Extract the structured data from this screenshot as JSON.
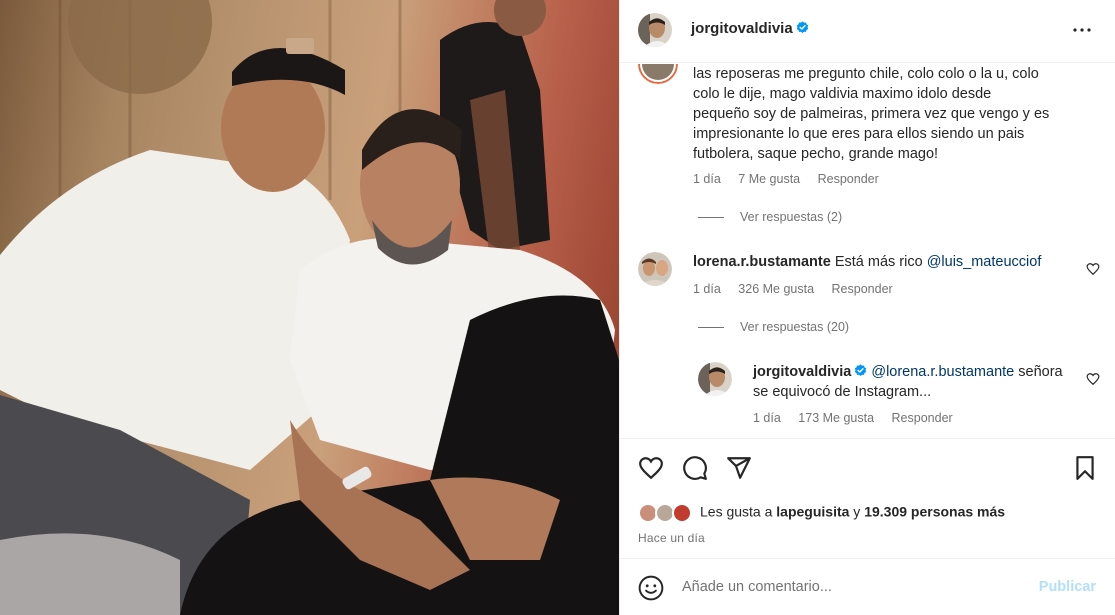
{
  "post": {
    "username": "jorgitovaldivia",
    "more_icon": "more-horizontal-icon"
  },
  "comments": {
    "first": {
      "lines": [
        "las reposeras me pregunto chile, colo colo o la u, colo",
        "colo le dije, mago valdivia maximo idolo desde",
        "pequeño soy de palmeiras, primera vez que vengo y es",
        "impresionante lo que eres para ellos siendo un pais",
        "futbolera, saque pecho, grande mago!"
      ],
      "time": "1 día",
      "likes": "7 Me gusta",
      "reply": "Responder",
      "view_replies": "Ver respuestas (2)"
    },
    "second": {
      "username": "lorena.r.bustamante",
      "text": "Está más rico ",
      "mention": "@luis_mateucciof",
      "time": "1 día",
      "likes": "326 Me gusta",
      "reply": "Responder",
      "view_replies": "Ver respuestas (20)"
    },
    "reply": {
      "username": "jorgitovaldivia",
      "mention": "@lorena.r.bustamante",
      "text_line1": " señora",
      "text_line2": "se equivocó de Instagram...",
      "time": "1 día",
      "likes": "173 Me gusta",
      "reply": "Responder"
    }
  },
  "actions": {
    "likes_prefix": "Les gusta a ",
    "likes_user": "lapeguisita",
    "likes_middle": " y ",
    "likes_count": "19.309 personas más",
    "time_ago": "Hace un día"
  },
  "compose": {
    "placeholder": "Añade un comentario...",
    "post_label": "Publicar"
  },
  "colors": {
    "verified": "#0095f6",
    "mention": "#00376b",
    "post_disabled": "#b2dffc",
    "secondary_text": "#737373"
  }
}
